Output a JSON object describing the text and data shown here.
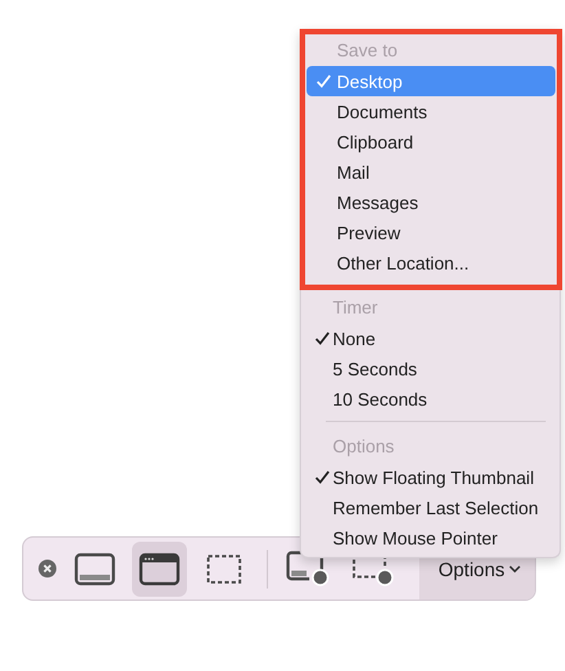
{
  "toolbar": {
    "capture_tools": [
      {
        "kind": "screen",
        "selected": false
      },
      {
        "kind": "window",
        "selected": true
      },
      {
        "kind": "selection",
        "selected": false
      }
    ],
    "record_tools": [
      {
        "kind": "record-screen",
        "selected": false
      },
      {
        "kind": "record-selection",
        "selected": false
      }
    ],
    "options_button": {
      "label": "Options"
    }
  },
  "menu": {
    "sections": [
      {
        "header": "Save to",
        "highlighted": true,
        "items": [
          {
            "label": "Desktop",
            "checked": true,
            "selected": true
          },
          {
            "label": "Documents",
            "checked": false,
            "selected": false
          },
          {
            "label": "Clipboard",
            "checked": false,
            "selected": false
          },
          {
            "label": "Mail",
            "checked": false,
            "selected": false
          },
          {
            "label": "Messages",
            "checked": false,
            "selected": false
          },
          {
            "label": "Preview",
            "checked": false,
            "selected": false
          },
          {
            "label": "Other Location...",
            "checked": false,
            "selected": false
          }
        ]
      },
      {
        "header": "Timer",
        "highlighted": false,
        "items": [
          {
            "label": "None",
            "checked": true,
            "selected": false
          },
          {
            "label": "5 Seconds",
            "checked": false,
            "selected": false
          },
          {
            "label": "10 Seconds",
            "checked": false,
            "selected": false
          }
        ]
      },
      {
        "header": "Options",
        "highlighted": false,
        "items": [
          {
            "label": "Show Floating Thumbnail",
            "checked": true,
            "selected": false
          },
          {
            "label": "Remember Last Selection",
            "checked": false,
            "selected": false
          },
          {
            "label": "Show Mouse Pointer",
            "checked": false,
            "selected": false
          }
        ]
      }
    ]
  }
}
